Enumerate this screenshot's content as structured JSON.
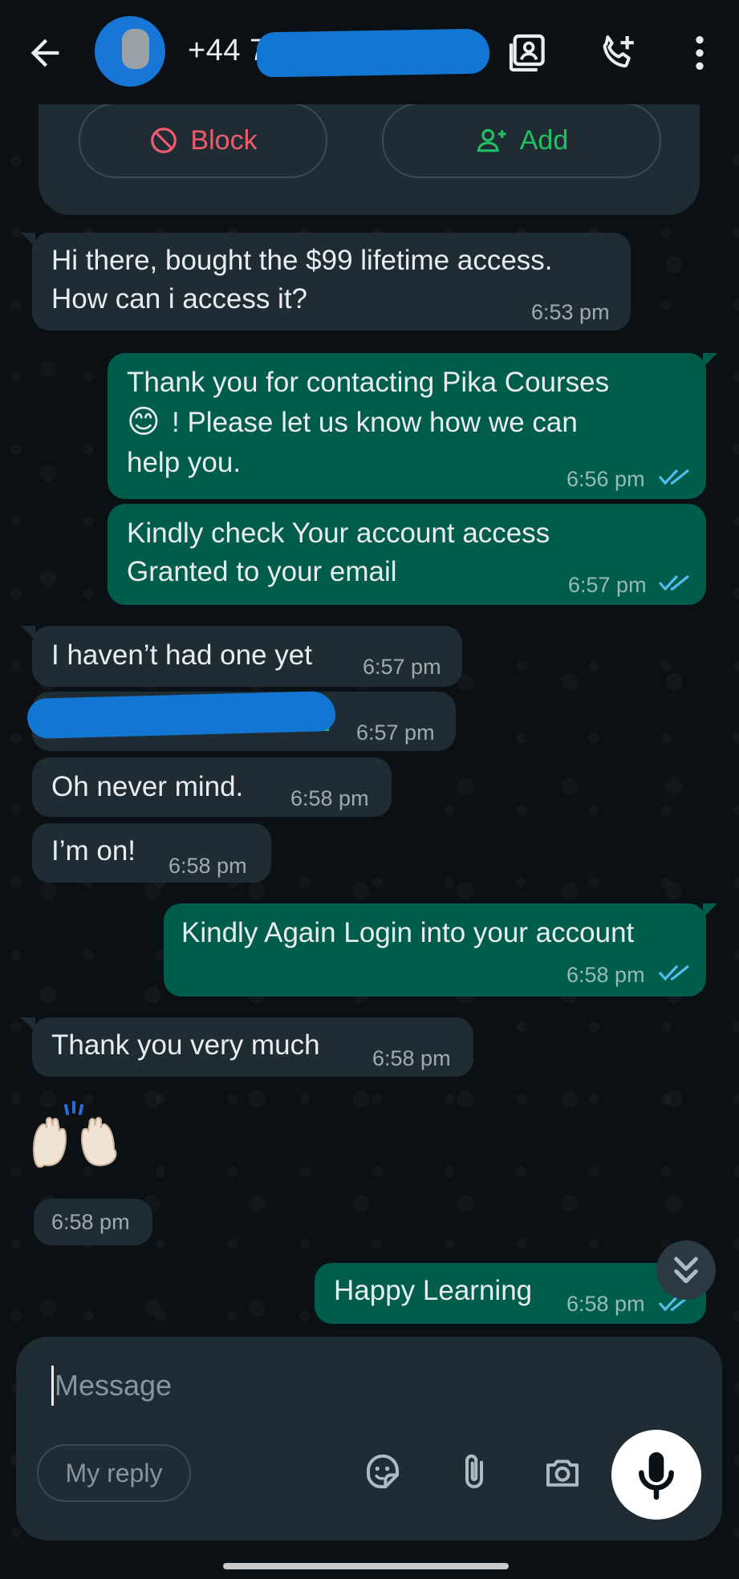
{
  "header": {
    "title": "+44 7",
    "back_icon": "arrow-left-icon",
    "actions": [
      "contact-card-icon",
      "add-call-icon",
      "more-vert-icon"
    ]
  },
  "top_card": {
    "block_label": "Block",
    "add_label": "Add"
  },
  "messages": [
    {
      "dir": "in",
      "lines": [
        "Hi there, bought the $99 lifetime access.",
        "How can i access it?"
      ],
      "time": "6:53 pm"
    },
    {
      "dir": "out",
      "lines": [
        "Thank you for contacting Pika Courses",
        "! Please let us know how we can",
        "help you."
      ],
      "emoji": "😊",
      "time": "6:56 pm"
    },
    {
      "dir": "out",
      "lines": [
        "Kindly check Your account access",
        "Granted to your email"
      ],
      "time": "6:57 pm"
    },
    {
      "dir": "in",
      "lines": [
        "I haven’t had one yet"
      ],
      "time": "6:57 pm"
    },
    {
      "dir": "in",
      "lines": [
        ""
      ],
      "time": "6:57 pm"
    },
    {
      "dir": "in",
      "lines": [
        "Oh never mind."
      ],
      "time": "6:58 pm"
    },
    {
      "dir": "in",
      "lines": [
        "I’m on!"
      ],
      "time": "6:58 pm"
    },
    {
      "dir": "out",
      "lines": [
        "Kindly Again Login into your account"
      ],
      "time": "6:58 pm"
    },
    {
      "dir": "in",
      "lines": [
        "Thank you very much"
      ],
      "time": "6:58 pm"
    },
    {
      "dir": "in",
      "lines": [
        "🙌"
      ],
      "time": "6:58 pm"
    },
    {
      "dir": "out",
      "lines": [
        "Happy Learning"
      ],
      "time": "6:58 pm"
    }
  ],
  "composer": {
    "placeholder": "Message",
    "reply_chip": "My reply",
    "icons": [
      "sticker-icon",
      "attach-icon",
      "camera-icon",
      "mic-icon"
    ]
  },
  "colors": {
    "incoming": "#1f2c34",
    "outgoing": "#005c4b",
    "read_ticks": "#53bdeb",
    "block_red": "#f15c6d",
    "add_green": "#21c063"
  }
}
